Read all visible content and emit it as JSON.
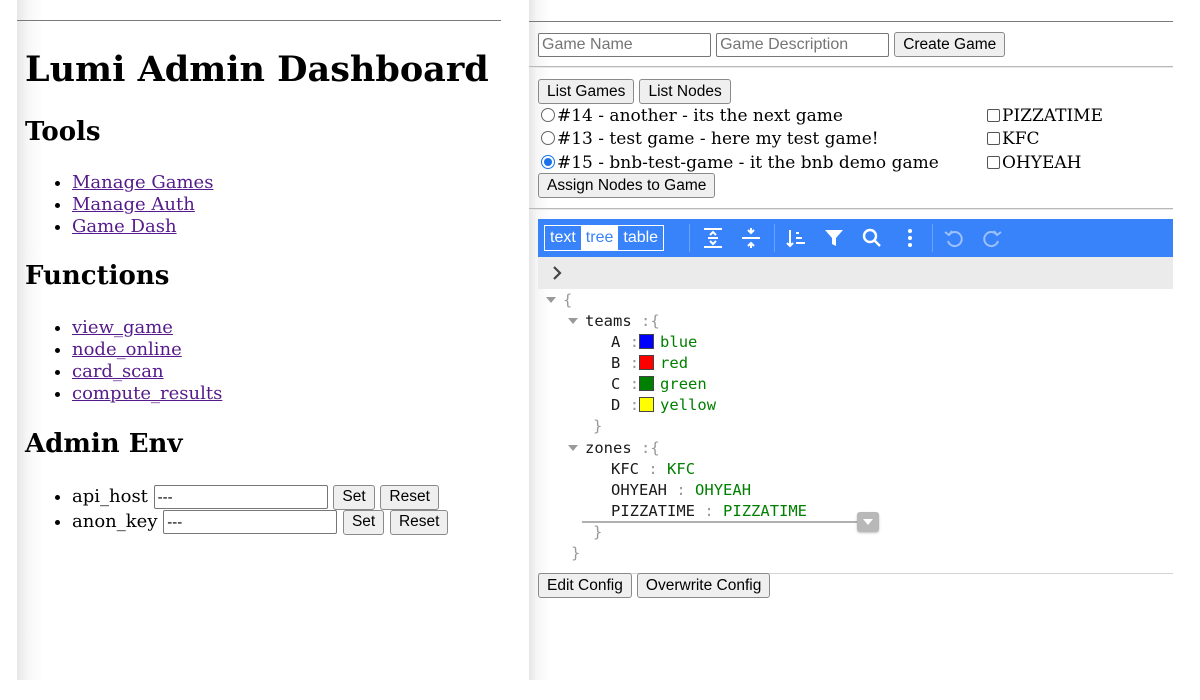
{
  "admin": {
    "title": "Lumi Admin Dashboard",
    "tools": {
      "heading": "Tools",
      "links": [
        "Manage Games",
        "Manage Auth",
        "Game Dash"
      ]
    },
    "functions": {
      "heading": "Functions",
      "links": [
        "view_game",
        "node_online",
        "card_scan",
        "compute_results"
      ]
    },
    "env": {
      "heading": "Admin Env",
      "items": [
        {
          "label": "api_host",
          "value": "---",
          "set": "Set",
          "reset": "Reset"
        },
        {
          "label": "anon_key",
          "value": "---",
          "set": "Set",
          "reset": "Reset"
        }
      ]
    }
  },
  "games": {
    "name_placeholder": "Game Name",
    "desc_placeholder": "Game Description",
    "create_label": "Create Game",
    "list_games_label": "List Games",
    "list_nodes_label": "List Nodes",
    "list": [
      {
        "label": "#14 - another - its the next game",
        "selected": false
      },
      {
        "label": "#13 - test game - here my test game!",
        "selected": false
      },
      {
        "label": "#15 - bnb-test-game - it the bnb demo game",
        "selected": true
      }
    ],
    "nodes": [
      {
        "label": "PIZZATIME",
        "checked": false
      },
      {
        "label": "KFC",
        "checked": false
      },
      {
        "label": "OHYEAH",
        "checked": false
      }
    ],
    "assign_label": "Assign Nodes to Game"
  },
  "editor": {
    "modes": [
      "text",
      "tree",
      "table"
    ],
    "active_mode": "tree",
    "toolbar_icons": [
      "expand-all-icon",
      "collapse-all-icon",
      "sort-icon",
      "filter-icon",
      "search-icon",
      "more-icon",
      "undo-icon",
      "redo-icon"
    ],
    "accent_color": "#3883fa",
    "open_brace": "{",
    "close_brace": "}",
    "colon": ":",
    "teams": {
      "key": "teams",
      "entries": [
        {
          "key": "A",
          "value": "blue",
          "color": "#0000ff"
        },
        {
          "key": "B",
          "value": "red",
          "color": "#ff0000"
        },
        {
          "key": "C",
          "value": "green",
          "color": "#008000"
        },
        {
          "key": "D",
          "value": "yellow",
          "color": "#ffff00"
        }
      ]
    },
    "zones": {
      "key": "zones",
      "entries": [
        {
          "key": "KFC",
          "value": "KFC"
        },
        {
          "key": "OHYEAH",
          "value": "OHYEAH"
        },
        {
          "key": "PIZZATIME",
          "value": "PIZZATIME"
        }
      ]
    }
  },
  "config": {
    "edit_label": "Edit Config",
    "overwrite_label": "Overwrite Config"
  }
}
